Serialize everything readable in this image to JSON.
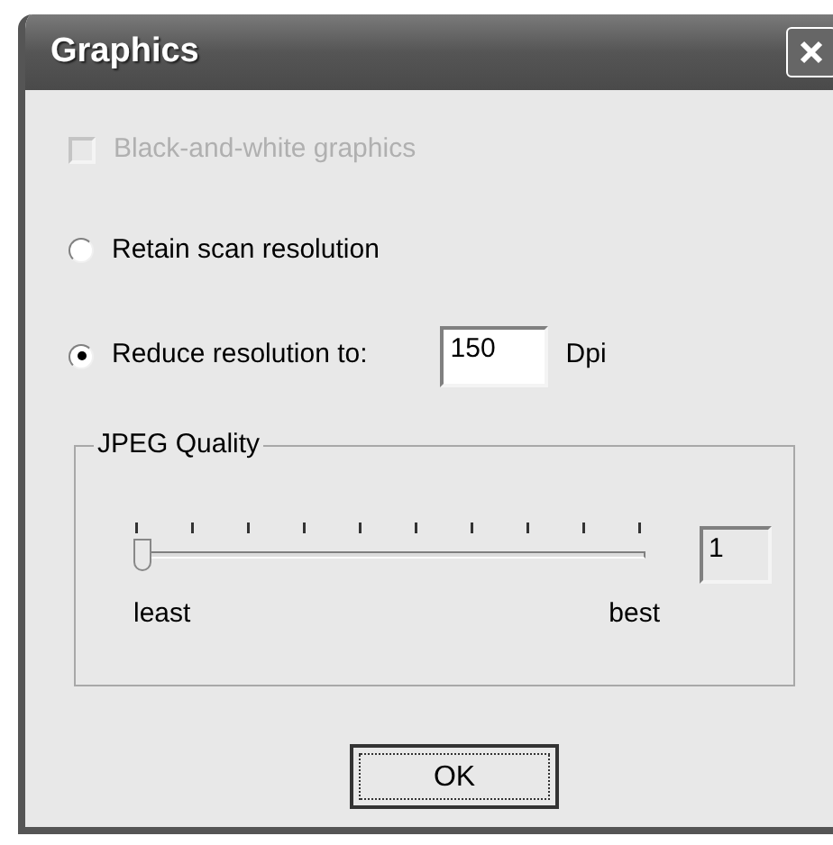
{
  "window": {
    "title": "Graphics"
  },
  "checkbox": {
    "label": "Black-and-white graphics",
    "checked": false,
    "disabled": true
  },
  "resolution_options": [
    {
      "label": "Retain scan resolution",
      "selected": false
    },
    {
      "label": "Reduce resolution to:",
      "selected": true
    }
  ],
  "resolution_field": {
    "value": "150",
    "unit": "Dpi"
  },
  "jpeg_quality": {
    "title": "JPEG Quality",
    "level": 0,
    "value": "1",
    "min_label": "least",
    "max_label": "best"
  },
  "buttons": [
    "OK"
  ]
}
